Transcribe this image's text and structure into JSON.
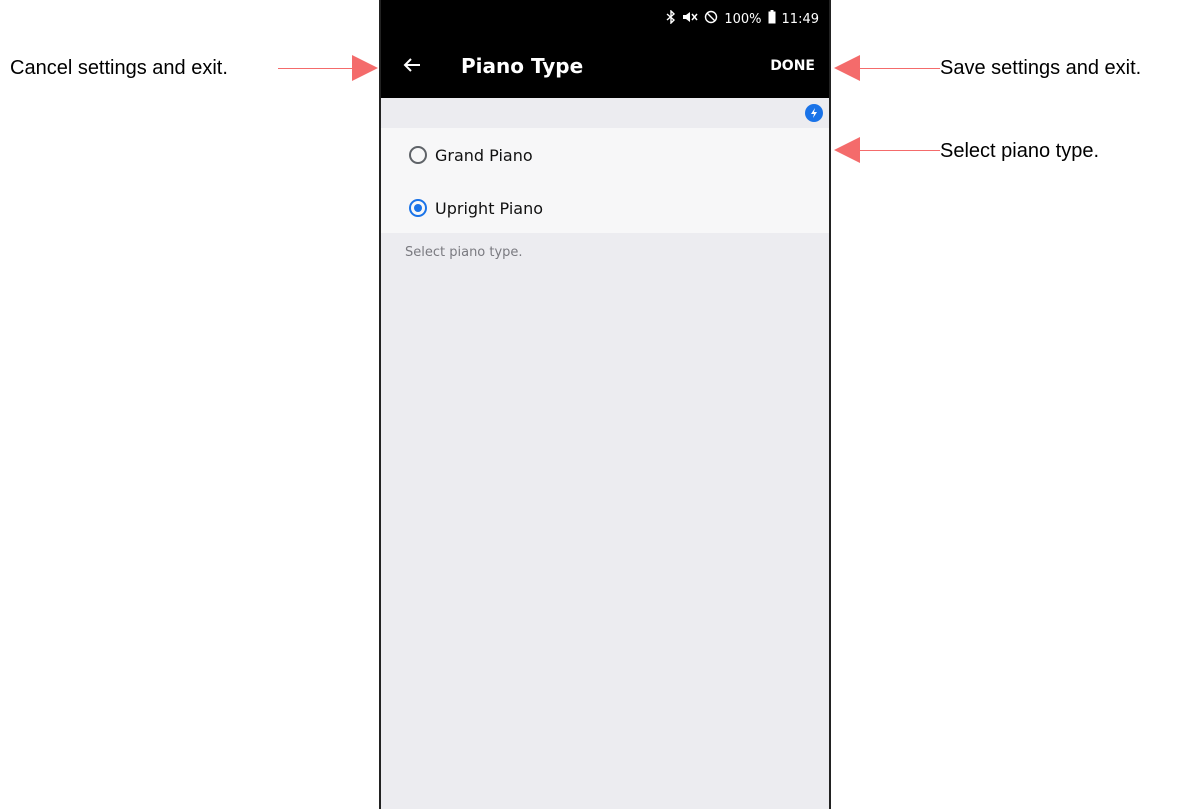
{
  "annotations": {
    "cancel": "Cancel settings and exit.",
    "save": "Save settings and exit.",
    "select": "Select piano type."
  },
  "statusbar": {
    "icons": [
      "bluetooth-icon",
      "mute-icon",
      "do-not-disturb-icon",
      "battery-icon"
    ],
    "battery": "100%",
    "time": "11:49"
  },
  "appbar": {
    "title": "Piano Type",
    "done_label": "DONE"
  },
  "options": [
    {
      "label": "Grand Piano",
      "selected": false
    },
    {
      "label": "Upright Piano",
      "selected": true
    }
  ],
  "help_text": "Select piano type.",
  "colors": {
    "accent": "#1a73e8",
    "arrow": "#f46b6b",
    "appbar_bg": "#000000",
    "screen_bg": "#ececf0"
  }
}
